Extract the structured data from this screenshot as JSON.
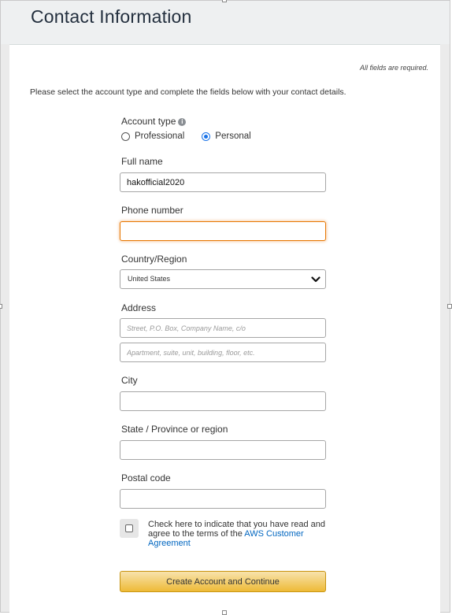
{
  "header": {
    "title": "Contact Information"
  },
  "form": {
    "required_note": "All fields are required.",
    "intro": "Please select the account type and complete the fields below with your contact details.",
    "account_type": {
      "label": "Account type",
      "info_icon": "info-icon",
      "options": [
        {
          "label": "Professional",
          "selected": false
        },
        {
          "label": "Personal",
          "selected": true
        }
      ]
    },
    "full_name": {
      "label": "Full name",
      "value": "hakofficial2020"
    },
    "phone": {
      "label": "Phone number",
      "value": ""
    },
    "country": {
      "label": "Country/Region",
      "selected": "United States",
      "icon": "chevron-down-icon"
    },
    "address": {
      "label": "Address",
      "line1_placeholder": "Street, P.O. Box, Company Name, c/o",
      "line2_placeholder": "Apartment, suite, unit, building, floor, etc."
    },
    "city": {
      "label": "City",
      "value": ""
    },
    "state": {
      "label": "State / Province or region",
      "value": ""
    },
    "postal": {
      "label": "Postal code",
      "value": ""
    },
    "agreement": {
      "text": "Check here to indicate that you have read and agree to the terms of the ",
      "link_text": "AWS Customer Agreement",
      "checked": false
    },
    "submit_label": "Create Account and Continue"
  },
  "colors": {
    "accent_blue": "#1a73e8",
    "focus_orange": "#e77600",
    "button_gold": "#eeba37",
    "link_blue": "#0066c0"
  }
}
